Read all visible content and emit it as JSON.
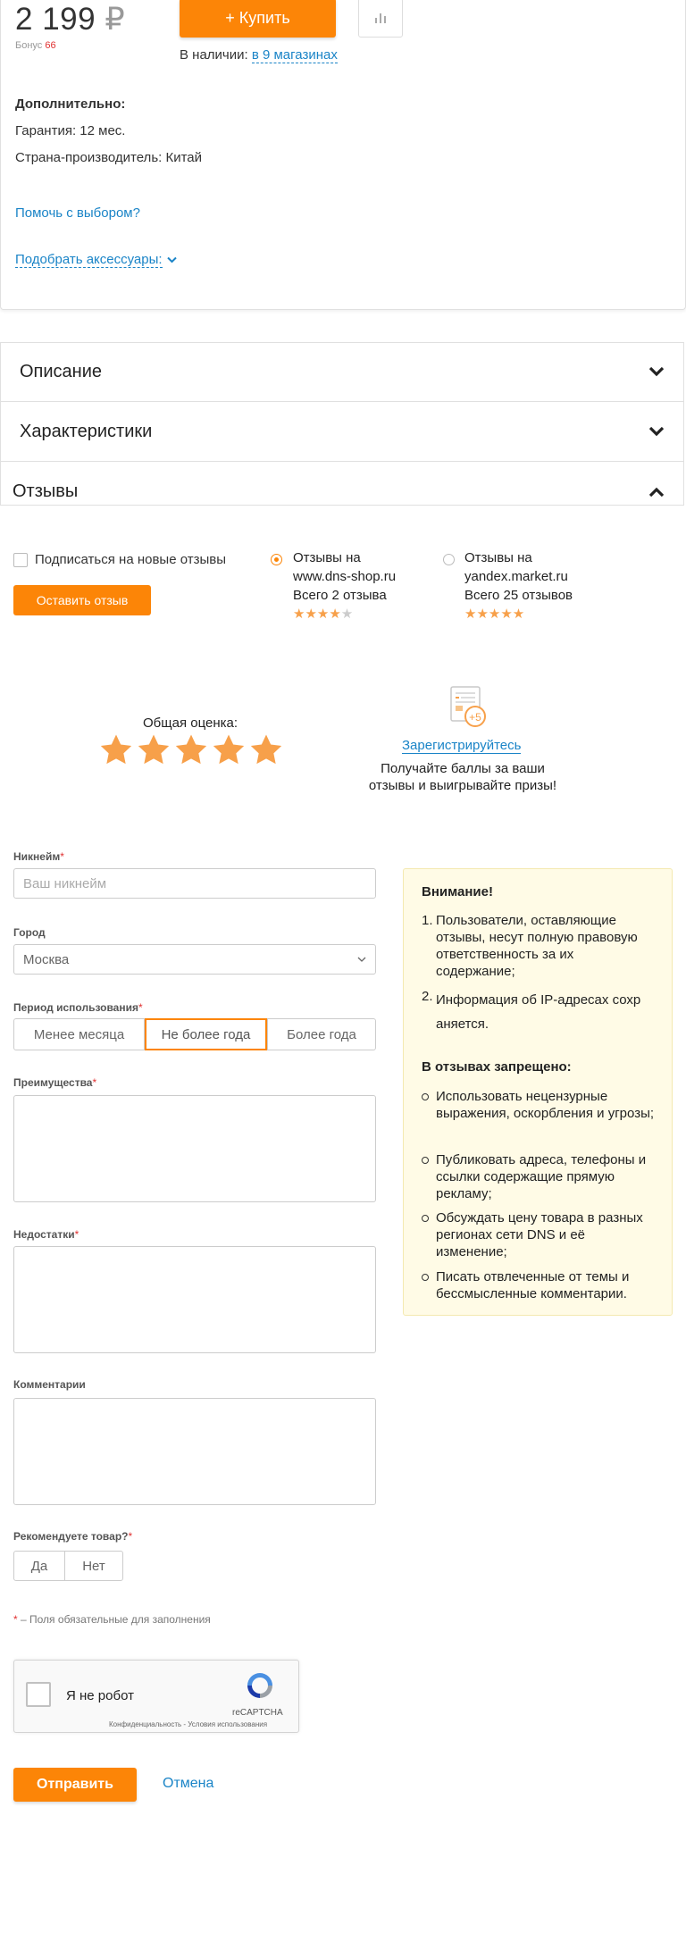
{
  "product": {
    "price": "2 199",
    "currency": "₽",
    "bonus_label": "Бонус",
    "bonus_value": "66",
    "buy_label": "+ Купить",
    "stock_prefix": "В наличии:",
    "stock_link": "в 9 магазинах",
    "extra_heading": "Дополнительно:",
    "warranty": "Гарантия: 12 мес.",
    "country": "Страна-производитель: Китай",
    "help_link": "Помочь с выбором?",
    "accessories_link": "Подобрать аксессуары:"
  },
  "sections": {
    "description": "Описание",
    "specs": "Характеристики",
    "reviews": "Отзывы"
  },
  "reviews": {
    "subscribe_label": "Подписаться на новые отзывы",
    "leave_button": "Оставить отзыв",
    "source1": {
      "line1": "Отзывы на",
      "line2": "www.dns-shop.ru",
      "count": "Всего 2 отзыва",
      "rating": 4
    },
    "source2": {
      "line1": "Отзывы на",
      "line2": "yandex.market.ru",
      "count": "Всего 25 отзывов",
      "rating": 5
    },
    "overall_label": "Общая оценка:",
    "overall_rating": 5,
    "register_badge": "+5",
    "register_link": "Зарегистрируйтесь",
    "register_text": "Получайте баллы за ваши отзывы и выигрывайте призы!"
  },
  "form": {
    "nickname_label": "Никнейм",
    "nickname_placeholder": "Ваш никнейм",
    "city_label": "Город",
    "city_value": "Москва",
    "period_label": "Период использования",
    "period_options": [
      "Менее месяца",
      "Не более года",
      "Более года"
    ],
    "period_selected": "Не более года",
    "pros_label": "Преимущества",
    "cons_label": "Недостатки",
    "comment_label": "Комментарии",
    "recommend_label": "Рекомендуете товар?",
    "recommend_options": [
      "Да",
      "Нет"
    ],
    "required_note": "– Поля обязательные для заполнения",
    "required_mark": "*",
    "captcha_label": "Я не робот",
    "captcha_brand": "reCAPTCHA",
    "captcha_links": "Конфиденциальность - Условия использования",
    "submit_label": "Отправить",
    "cancel_label": "Отмена"
  },
  "notice": {
    "heading": "Внимание!",
    "items": [
      "Пользователи, оставляющие отзывы, несут полную правовую ответственность за их содержание;",
      "Информация об IP-адресах сохр аняется."
    ],
    "forbidden_heading": "В отзывах запрещено:",
    "forbidden": [
      "Использовать нецензурные выражения, оскорбления и угрозы;",
      "Публиковать адреса, телефоны и ссылки содержащие прямую рекламу;",
      "Обсуждать цену товара в разных регионах сети DNS и её изменение;",
      "Писать отвлеченные от темы и бессмысленные комментарии."
    ]
  },
  "colors": {
    "accent": "#fc8507",
    "link": "#1a84c7",
    "required": "#e03131",
    "star": "#f7a04a",
    "notice_bg": "#fffbe6"
  }
}
